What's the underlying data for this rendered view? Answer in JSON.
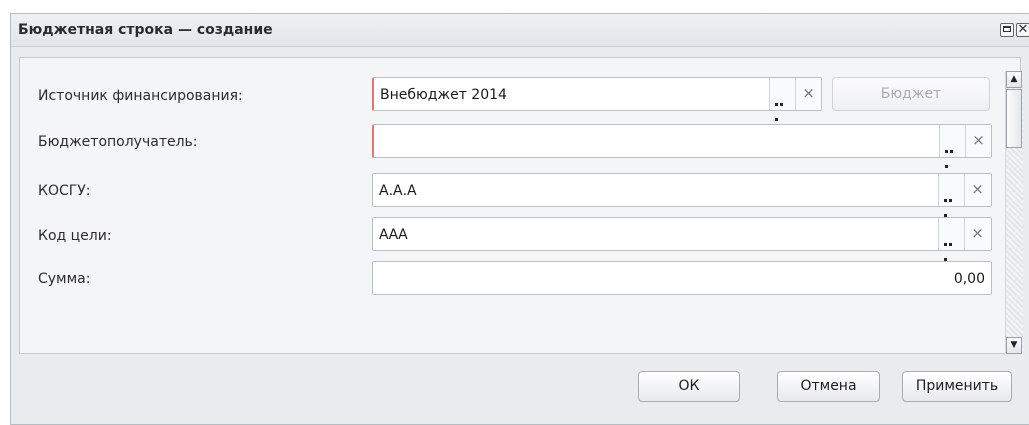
{
  "dialog": {
    "title": "Бюджетная строка — создание",
    "maximize_icon": "maximize-icon",
    "close_glyph": "✕"
  },
  "form": {
    "fields": [
      {
        "label": "Источник финансирования:",
        "value": "Внебюджет 2014",
        "required": true
      },
      {
        "label": "Бюджетополучатель:",
        "value": "",
        "required": true
      },
      {
        "label": "КОСГУ:",
        "value": "А.А.А",
        "required": false
      },
      {
        "label": "Код цели:",
        "value": "ААА",
        "required": false
      },
      {
        "label": "Сумма:",
        "value": "0,00",
        "required": false
      }
    ],
    "budget_button": "Бюджет",
    "clear_glyph": "×"
  },
  "scrollbar": {
    "up": "▲",
    "down": "▼"
  },
  "footer": {
    "ok": "ОК",
    "cancel": "Отмена",
    "apply": "Применить"
  }
}
